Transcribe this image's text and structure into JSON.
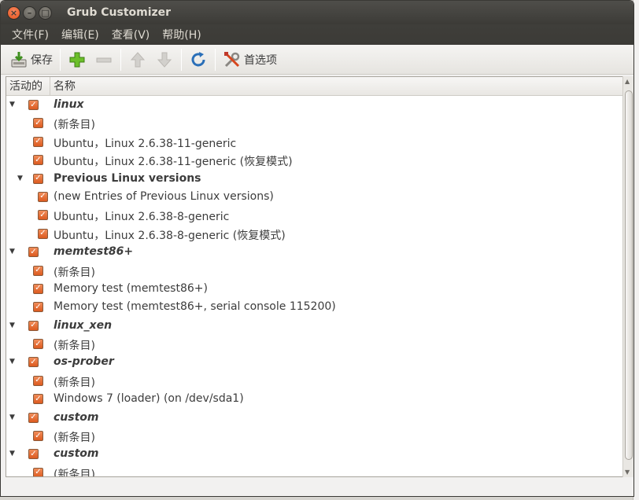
{
  "window": {
    "title": "Grub Customizer",
    "buttons": {
      "close": "×",
      "minimize": "–",
      "maximize": "□"
    }
  },
  "menubar": {
    "items": [
      {
        "label": "文件(F)"
      },
      {
        "label": "编辑(E)"
      },
      {
        "label": "查看(V)"
      },
      {
        "label": "帮助(H)"
      }
    ]
  },
  "toolbar": {
    "save_label": "保存",
    "preferences_label": "首选项",
    "icons": [
      "save-icon",
      "add-icon",
      "remove-icon",
      "up-icon",
      "down-icon",
      "refresh-icon",
      "preferences-icon"
    ]
  },
  "tree": {
    "columns": {
      "active": "活动的",
      "name": "名称"
    },
    "rows": [
      {
        "label": "linux",
        "kind": "script",
        "level": 0,
        "expander": true,
        "checked": true
      },
      {
        "label": "(新条目)",
        "kind": "entry",
        "level": 1,
        "expander": false,
        "checked": true
      },
      {
        "label": "Ubuntu，Linux 2.6.38-11-generic",
        "kind": "entry",
        "level": 1,
        "expander": false,
        "checked": true
      },
      {
        "label": "Ubuntu，Linux 2.6.38-11-generic (恢复模式)",
        "kind": "entry",
        "level": 1,
        "expander": false,
        "checked": true
      },
      {
        "label": "Previous Linux versions",
        "kind": "submenu",
        "level": 1,
        "expander": true,
        "checked": true
      },
      {
        "label": "(new Entries of Previous Linux versions)",
        "kind": "entry",
        "level": 2,
        "expander": false,
        "checked": true
      },
      {
        "label": "Ubuntu，Linux 2.6.38-8-generic",
        "kind": "entry",
        "level": 2,
        "expander": false,
        "checked": true
      },
      {
        "label": "Ubuntu，Linux 2.6.38-8-generic (恢复模式)",
        "kind": "entry",
        "level": 2,
        "expander": false,
        "checked": true
      },
      {
        "label": "memtest86+",
        "kind": "script",
        "level": 0,
        "expander": true,
        "checked": true
      },
      {
        "label": "(新条目)",
        "kind": "entry",
        "level": 1,
        "expander": false,
        "checked": true
      },
      {
        "label": "Memory test (memtest86+)",
        "kind": "entry",
        "level": 1,
        "expander": false,
        "checked": true
      },
      {
        "label": "Memory test (memtest86+, serial console 115200)",
        "kind": "entry",
        "level": 1,
        "expander": false,
        "checked": true
      },
      {
        "label": "linux_xen",
        "kind": "script",
        "level": 0,
        "expander": true,
        "checked": true
      },
      {
        "label": "(新条目)",
        "kind": "entry",
        "level": 1,
        "expander": false,
        "checked": true
      },
      {
        "label": "os-prober",
        "kind": "script",
        "level": 0,
        "expander": true,
        "checked": true
      },
      {
        "label": "(新条目)",
        "kind": "entry",
        "level": 1,
        "expander": false,
        "checked": true
      },
      {
        "label": "Windows 7 (loader) (on /dev/sda1)",
        "kind": "entry",
        "level": 1,
        "expander": false,
        "checked": true
      },
      {
        "label": "custom",
        "kind": "script",
        "level": 0,
        "expander": true,
        "checked": true
      },
      {
        "label": "(新条目)",
        "kind": "entry",
        "level": 1,
        "expander": false,
        "checked": true
      },
      {
        "label": "custom",
        "kind": "script",
        "level": 0,
        "expander": true,
        "checked": true
      },
      {
        "label": "(新条目)",
        "kind": "entry",
        "level": 1,
        "expander": false,
        "checked": true
      }
    ]
  },
  "colors": {
    "titlebar": "#3c3b37",
    "checkbox_accent": "#e3541d",
    "close_button": "#e3541d"
  }
}
